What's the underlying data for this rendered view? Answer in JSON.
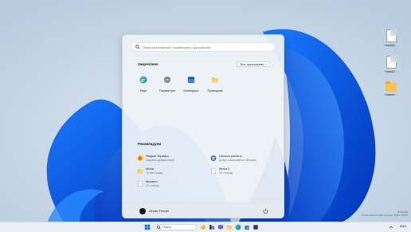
{
  "desktop": {
    "icons": [
      {
        "label": "Новый..."
      },
      {
        "label": "Новый..."
      },
      {
        "label": "Новый..."
      }
    ]
  },
  "start": {
    "search_placeholder": "Поиск приложений, параметров и документов",
    "pinned_title": "Закреплено",
    "all_apps_label": "Все приложения",
    "pinned": [
      {
        "label": "Edge",
        "icon": "edge-icon"
      },
      {
        "label": "Параметры",
        "icon": "settings-icon"
      },
      {
        "label": "Календарь",
        "icon": "calendar-icon"
      },
      {
        "label": "Проводник",
        "icon": "folder-icon"
      }
    ],
    "recommended_title": "Рекомендуем",
    "recommended": [
      {
        "title": "Яндекс.Музыка",
        "sub": "Недавно добавленные",
        "icon": "music-icon"
      },
      {
        "title": "Начало работы",
        "sub": "Добро пожаловать в Windows",
        "icon": "get-started-icon"
      },
      {
        "title": "Мини",
        "sub": "16 мин назад",
        "icon": "folder-icon"
      },
      {
        "title": "Мини 2",
        "sub": "16 ч назад",
        "icon": "document-icon"
      },
      {
        "title": "Минили",
        "sub": "23 ч назад",
        "icon": "document-icon"
      }
    ],
    "user_name": "Zinder Fender"
  },
  "taskbar": {
    "search_placeholder": "Поиск",
    "language": "ENG"
  },
  "watermark": {
    "line1": "Windows",
    "line2": "Ознакомительная версия. Build 22000"
  },
  "colors": {
    "accent": "#0a5fd6",
    "wallpaper_bg": "#c7d7e6"
  }
}
